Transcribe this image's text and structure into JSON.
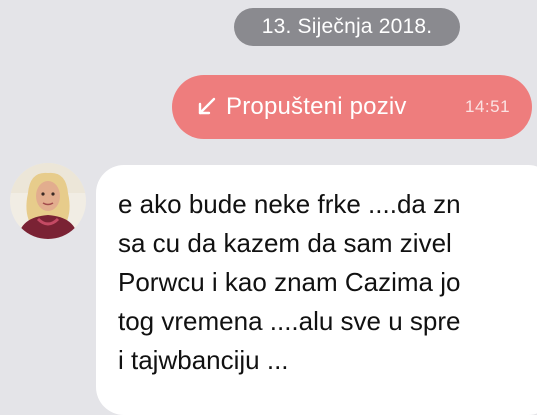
{
  "date_separator": "13. Siječnja 2018.",
  "missed_call": {
    "icon": "missed-call-arrow-icon",
    "label": "Propušteni poziv",
    "time": "14:51",
    "color": "#ee7d7d"
  },
  "message": {
    "avatar": "contact-avatar",
    "lines": [
      "e ako bude neke frke ....da zn",
      "sa cu da kazem da sam zivel",
      "Porwcu i kao znam Cazima jo",
      "tog vremena ....alu sve u spre",
      "i tajwbanciju ..."
    ]
  }
}
